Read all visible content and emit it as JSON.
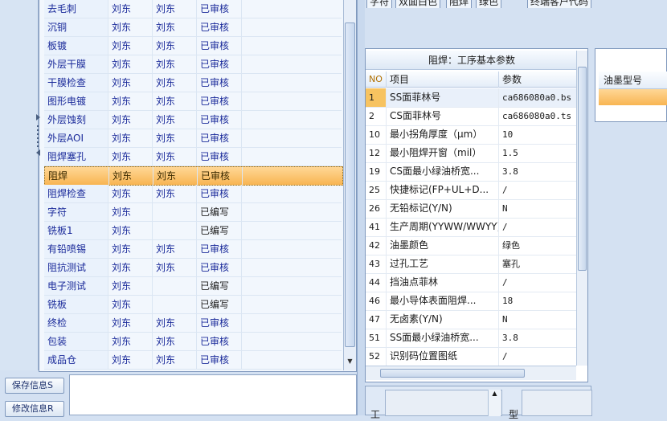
{
  "processes": [
    {
      "name": "去毛刺",
      "p1": "刘东",
      "p2": "刘东",
      "status": "已审核"
    },
    {
      "name": "沉铜",
      "p1": "刘东",
      "p2": "刘东",
      "status": "已审核"
    },
    {
      "name": "板镀",
      "p1": "刘东",
      "p2": "刘东",
      "status": "已审核"
    },
    {
      "name": "外层干膜",
      "p1": "刘东",
      "p2": "刘东",
      "status": "已审核"
    },
    {
      "name": "干膜检查",
      "p1": "刘东",
      "p2": "刘东",
      "status": "已审核"
    },
    {
      "name": "图形电镀",
      "p1": "刘东",
      "p2": "刘东",
      "status": "已审核"
    },
    {
      "name": "外层蚀刻",
      "p1": "刘东",
      "p2": "刘东",
      "status": "已审核"
    },
    {
      "name": "外层AOI",
      "p1": "刘东",
      "p2": "刘东",
      "status": "已审核"
    },
    {
      "name": "阻焊塞孔",
      "p1": "刘东",
      "p2": "刘东",
      "status": "已审核"
    },
    {
      "name": "阻焊",
      "p1": "刘东",
      "p2": "刘东",
      "status": "已审核"
    },
    {
      "name": "阻焊检查",
      "p1": "刘东",
      "p2": "刘东",
      "status": "已审核"
    },
    {
      "name": "字符",
      "p1": "刘东",
      "p2": "",
      "status": "已编写"
    },
    {
      "name": "铣板1",
      "p1": "刘东",
      "p2": "",
      "status": "已编写"
    },
    {
      "name": "有铅喷锡",
      "p1": "刘东",
      "p2": "刘东",
      "status": "已审核"
    },
    {
      "name": "阻抗测试",
      "p1": "刘东",
      "p2": "刘东",
      "status": "已审核"
    },
    {
      "name": "电子测试",
      "p1": "刘东",
      "p2": "",
      "status": "已编写"
    },
    {
      "name": "铣板",
      "p1": "刘东",
      "p2": "",
      "status": "已编写"
    },
    {
      "name": "终检",
      "p1": "刘东",
      "p2": "刘东",
      "status": "已审核"
    },
    {
      "name": "包装",
      "p1": "刘东",
      "p2": "刘东",
      "status": "已审核"
    },
    {
      "name": "成品仓",
      "p1": "刘东",
      "p2": "刘东",
      "status": "已审核"
    }
  ],
  "selected_process_index": 9,
  "buttons": {
    "save": "保存信息S",
    "edit": "修改信息R"
  },
  "tabs": [
    "字符",
    "双面白色",
    "阻焊",
    "绿色",
    "终端客户代码"
  ],
  "params": {
    "title": "阻焊：工序基本参数",
    "headers": {
      "no": "NO",
      "item": "项目",
      "value": "参数"
    },
    "rows": [
      {
        "no": "1",
        "item": "SS面菲林号",
        "value": "ca686080a0.bs"
      },
      {
        "no": "2",
        "item": "CS面菲林号",
        "value": "ca686080a0.ts"
      },
      {
        "no": "10",
        "item": "最小拐角厚度（μm）",
        "value": "10"
      },
      {
        "no": "12",
        "item": "最小阻焊开窗（mil）",
        "value": "1.5"
      },
      {
        "no": "19",
        "item": "CS面最小绿油桥宽...",
        "value": "3.8"
      },
      {
        "no": "25",
        "item": "快捷标记(FP+UL+D...",
        "value": "/"
      },
      {
        "no": "26",
        "item": "无铅标记(Y/N)",
        "value": "N"
      },
      {
        "no": "41",
        "item": "生产周期(YYWW/WWYY)",
        "value": "/"
      },
      {
        "no": "42",
        "item": "油墨颜色",
        "value": "绿色"
      },
      {
        "no": "43",
        "item": "过孔工艺",
        "value": "塞孔"
      },
      {
        "no": "44",
        "item": "挡油点菲林",
        "value": "/"
      },
      {
        "no": "46",
        "item": "最小导体表面阻焊...",
        "value": "18"
      },
      {
        "no": "47",
        "item": "无卤素(Y/N)",
        "value": "N"
      },
      {
        "no": "51",
        "item": "SS面最小绿油桥宽...",
        "value": "3.8"
      },
      {
        "no": "52",
        "item": "识别码位置图纸",
        "value": "/"
      }
    ]
  },
  "ink": {
    "header": "油墨型号"
  },
  "bottom": {
    "label1": "工",
    "label2": "型"
  },
  "colors": {
    "selection": "#f8b552",
    "link_blue": "#1a2a9a"
  }
}
